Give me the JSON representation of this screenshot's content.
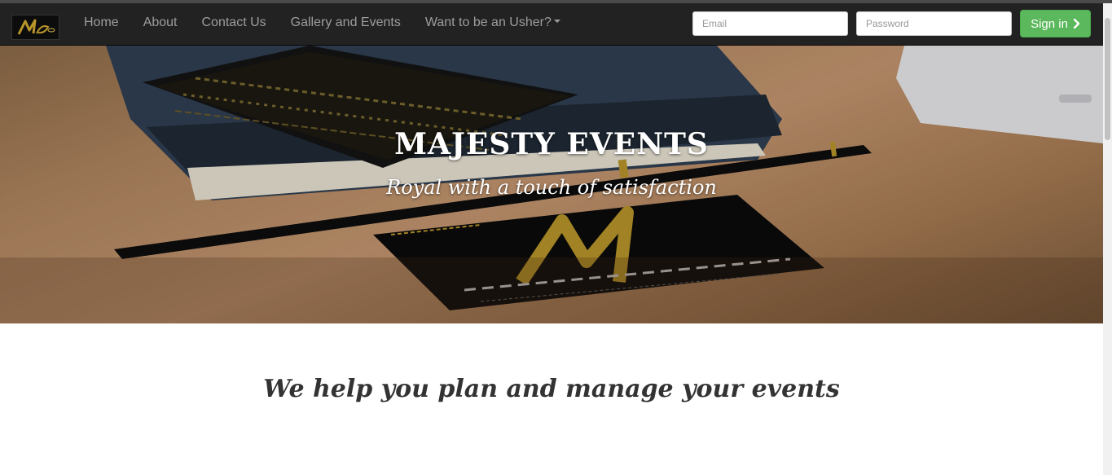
{
  "navbar": {
    "brand_icon": "majesty-m-logo",
    "links": [
      {
        "label": "Home"
      },
      {
        "label": "About"
      },
      {
        "label": "Contact Us"
      },
      {
        "label": "Gallery and Events"
      },
      {
        "label": "Want to be an Usher?"
      }
    ]
  },
  "login": {
    "email_placeholder": "Email",
    "password_placeholder": "Password",
    "signin_label": "Sign in",
    "signin_icon": "chevron-right-icon"
  },
  "hero": {
    "title": "MAJESTY EVENTS",
    "subtitle": "Royal with a touch of satisfaction"
  },
  "main": {
    "tagline": "We help you plan and manage your events"
  },
  "colors": {
    "navbar": "#222222",
    "nav_text": "#9d9d9d",
    "signin": "#5cb85c",
    "gold": "#b8952a"
  }
}
